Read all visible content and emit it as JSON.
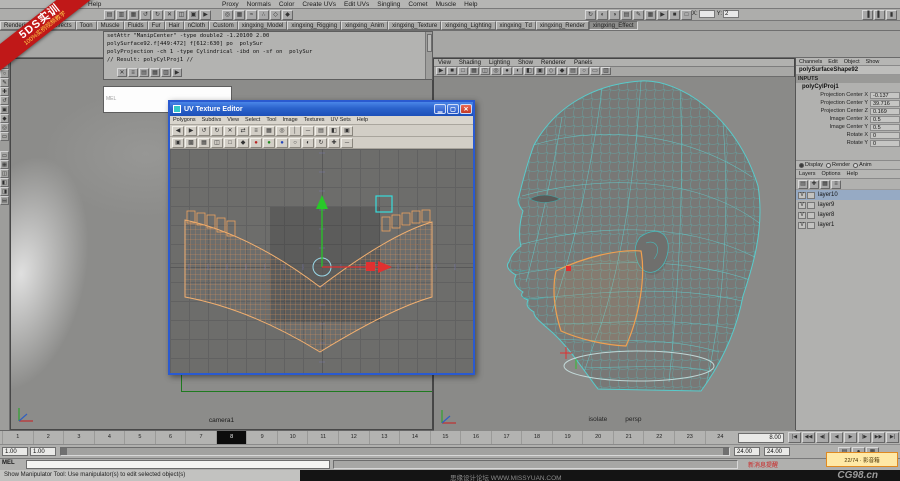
{
  "ribbon": {
    "line1": "5DS实训",
    "line2": "100%实例视频教学"
  },
  "menubar": {
    "script_menu": "Help",
    "items": [
      "Proxy",
      "Normals",
      "Color",
      "Create UVs",
      "Edit UVs",
      "Singling",
      "Comet",
      "Muscle",
      "Help"
    ]
  },
  "statusbar": {
    "left_icons": [
      {
        "n": "new-scene-icon",
        "g": "▤"
      },
      {
        "n": "open-scene-icon",
        "g": "▥"
      },
      {
        "n": "save-scene-icon",
        "g": "▦"
      },
      {
        "n": "undo-icon",
        "g": "↺"
      },
      {
        "n": "redo-icon",
        "g": "↻"
      },
      {
        "n": "cut-icon",
        "g": "✕"
      },
      {
        "n": "copy-icon",
        "g": "◫"
      },
      {
        "n": "paste-icon",
        "g": "▣"
      },
      {
        "n": "select-mode-icon",
        "g": "▶"
      }
    ],
    "mid_icons": [
      {
        "n": "highlight-selection-icon",
        "g": "◎"
      },
      {
        "n": "snap-grid-icon",
        "g": "▦"
      },
      {
        "n": "snap-curve-icon",
        "g": "≈"
      },
      {
        "n": "snap-point-icon",
        "g": "∴"
      },
      {
        "n": "snap-plane-icon",
        "g": "◇"
      },
      {
        "n": "make-live-icon",
        "g": "◆"
      }
    ],
    "right_icons": [
      {
        "n": "construction-history-icon",
        "g": "↻"
      },
      {
        "n": "render-current-frame-icon",
        "g": "◐"
      },
      {
        "n": "ipr-render-icon",
        "g": "◑"
      },
      {
        "n": "render-settings-icon",
        "g": "▤"
      },
      {
        "n": "paint-effects-icon",
        "g": "✎"
      },
      {
        "n": "hypershade-icon",
        "g": "▦"
      },
      {
        "n": "quick-select-icon",
        "g": "▶"
      },
      {
        "n": "object-mode-icon",
        "g": "■"
      },
      {
        "n": "component-mode-icon",
        "g": "□"
      }
    ],
    "coord_fields": [
      {
        "label": "X:",
        "value": ""
      },
      {
        "label": "Y:",
        "value": "2"
      }
    ],
    "panel_toggles": [
      {
        "n": "toggle-attribute-editor-icon",
        "g": "▐"
      },
      {
        "n": "toggle-tool-settings-icon",
        "g": "▌"
      },
      {
        "n": "toggle-channel-box-icon",
        "g": "▮"
      }
    ]
  },
  "shelf": {
    "tabs": [
      "Rendering",
      "PaintEffects",
      "Toon",
      "Muscle",
      "Fluids",
      "Fur",
      "Hair",
      "nCloth",
      "Custom",
      "xingxing_Model",
      "xingxing_Rigging",
      "xingxing_Anim",
      "xingxing_Texture",
      "xingxing_Lighting",
      "xingxing_Td",
      "xingxing_Render",
      "xingxing_Effect"
    ],
    "active": "xingxing_Effect"
  },
  "toolbox": {
    "tools": [
      {
        "n": "select-tool-icon",
        "g": "▶"
      },
      {
        "n": "lasso-tool-icon",
        "g": "○"
      },
      {
        "n": "paint-select-tool-icon",
        "g": "✎"
      },
      {
        "n": "move-tool-icon",
        "g": "✚"
      },
      {
        "n": "rotate-tool-icon",
        "g": "↺"
      },
      {
        "n": "scale-tool-icon",
        "g": "▣"
      },
      {
        "n": "universal-manip-tool-icon",
        "g": "◆"
      },
      {
        "n": "show-manip-tool-icon",
        "g": "◎"
      },
      {
        "n": "last-tool-icon",
        "g": "▭"
      }
    ],
    "layouts": [
      {
        "n": "single-pane-layout-icon",
        "g": "▭"
      },
      {
        "n": "four-pane-layout-icon",
        "g": "▦"
      },
      {
        "n": "two-pane-layout-icon",
        "g": "◫"
      },
      {
        "n": "persp-outliner-layout-icon",
        "g": "◧"
      },
      {
        "n": "persp-graph-layout-icon",
        "g": "◨"
      },
      {
        "n": "uv-persp-layout-icon",
        "g": "▤"
      }
    ]
  },
  "script_panel": {
    "output_lines": [
      "setAttr \"ManipCenter\" -type double2 -1.20100 2.00",
      "polySurface92.f[449:472] f[612:630] po  polySur",
      "polyProjection -ch 1 -type Cylindrical -ibd on -sf on  polySur",
      "// Result: polyCylProj1 //"
    ],
    "icons": [
      {
        "n": "clear-history-icon",
        "g": "✕"
      },
      {
        "n": "echo-commands-icon",
        "g": "≡"
      },
      {
        "n": "line-numbers-icon",
        "g": "▤"
      },
      {
        "n": "save-script-icon",
        "g": "▦"
      },
      {
        "n": "load-script-icon",
        "g": "▥"
      },
      {
        "n": "execute-script-icon",
        "g": "▶"
      }
    ],
    "input_label": "MEL"
  },
  "left_viewport": {
    "camera_label": "camera1",
    "icons": [
      {
        "n": "camera-attributes-icon",
        "g": "▣"
      },
      {
        "n": "bookmark-icon",
        "g": "◆"
      },
      {
        "n": "image-plane-icon",
        "g": "▦"
      },
      {
        "n": "pan-zoom-icon",
        "g": "✚"
      },
      {
        "n": "grease-pencil-icon",
        "g": "✎"
      },
      {
        "n": "film-gate-icon",
        "g": "□"
      }
    ]
  },
  "right_viewport": {
    "menus": [
      "View",
      "Shading",
      "Lighting",
      "Show",
      "Renderer",
      "Panels"
    ],
    "icons": [
      {
        "n": "select-camera-icon",
        "g": "▶"
      },
      {
        "n": "lock-camera-icon",
        "g": "■"
      },
      {
        "n": "camera-attributes-icon",
        "g": "□"
      },
      {
        "n": "grid-toggle-icon",
        "g": "▦"
      },
      {
        "n": "film-gate-icon",
        "g": "◫"
      },
      {
        "n": "resolution-gate-icon",
        "g": "◎"
      },
      {
        "n": "gate-mask-icon",
        "g": "●"
      },
      {
        "n": "field-chart-icon",
        "g": "◐"
      },
      {
        "n": "safe-action-icon",
        "g": "◧"
      },
      {
        "n": "safe-title-icon",
        "g": "▣"
      },
      {
        "n": "wireframe-display-icon",
        "g": "◇"
      },
      {
        "n": "smooth-shade-icon",
        "g": "◆"
      },
      {
        "n": "textured-display-icon",
        "g": "▤"
      },
      {
        "n": "lights-display-icon",
        "g": "○"
      },
      {
        "n": "isolate-select-icon",
        "g": "▭"
      },
      {
        "n": "xray-display-icon",
        "g": "▥"
      }
    ],
    "labels": {
      "left": "isolate",
      "right": "persp"
    }
  },
  "uv_editor": {
    "title": "UV Texture Editor",
    "menus": [
      "Polygons",
      "Subdivs",
      "View",
      "Select",
      "Tool",
      "Image",
      "Textures",
      "UV Sets",
      "Help"
    ],
    "window_buttons": [
      {
        "n": "minimize-button",
        "g": "▁"
      },
      {
        "n": "maximize-button",
        "g": "▢"
      }
    ],
    "close_button": "✕",
    "toolbar1": [
      {
        "n": "flip-u-icon",
        "g": "◀"
      },
      {
        "n": "flip-v-icon",
        "g": "▶"
      },
      {
        "n": "rotate-uv-ccw-icon",
        "g": "↺"
      },
      {
        "n": "rotate-uv-cw-icon",
        "g": "↻"
      },
      {
        "n": "cut-uv-icon",
        "g": "✕"
      },
      {
        "n": "sew-uv-icon",
        "g": "⇄"
      },
      {
        "n": "move-sew-uv-icon",
        "g": "≡"
      },
      {
        "n": "layout-uv-icon",
        "g": "▦"
      },
      {
        "n": "cycle-uv-icon",
        "g": "◎"
      },
      {
        "n": "align-u-icon",
        "g": "│"
      },
      {
        "n": "align-v-icon",
        "g": "─"
      },
      {
        "n": "grid-uv-icon",
        "g": "▤"
      },
      {
        "n": "isolate-uv-icon",
        "g": "◧"
      },
      {
        "n": "uv-options-icon",
        "g": "▣"
      }
    ],
    "toolbar2": [
      {
        "n": "display-image-icon",
        "g": "▣"
      },
      {
        "n": "dim-image-icon",
        "g": "▩"
      },
      {
        "n": "view-grid-icon",
        "g": "▦"
      },
      {
        "n": "pixel-snap-icon",
        "g": "◫"
      },
      {
        "n": "texture-borders-icon",
        "g": "□"
      },
      {
        "n": "shaded-uv-icon",
        "g": "◆"
      },
      {
        "n": "red-channel-icon",
        "g": "●"
      },
      {
        "n": "green-channel-icon",
        "g": "●"
      },
      {
        "n": "blue-channel-icon",
        "g": "●"
      },
      {
        "n": "alpha-channel-icon",
        "g": "○"
      },
      {
        "n": "uv-snapshot-icon",
        "g": "◐"
      },
      {
        "n": "refresh-view-icon",
        "g": "↻"
      },
      {
        "n": "zoom-in-icon",
        "g": "✚"
      },
      {
        "n": "zoom-out-icon",
        "g": "─"
      }
    ]
  },
  "channel_box": {
    "menus": [
      "Channels",
      "Edit",
      "Object",
      "Show"
    ],
    "object_name": "polySurfaceShape92",
    "section": "INPUTS",
    "node_name": "polyCylProj1",
    "attributes": [
      {
        "label": "Projection Center X",
        "value": "-0.137"
      },
      {
        "label": "Projection Center Y",
        "value": "39.716"
      },
      {
        "label": "Projection Center Z",
        "value": "0.169"
      },
      {
        "label": "Image Center X",
        "value": "0.5"
      },
      {
        "label": "Image Center Y",
        "value": "0.5"
      },
      {
        "label": "Rotate X",
        "value": "0"
      },
      {
        "label": "Rotate Y",
        "value": "0"
      }
    ],
    "display_modes": [
      "Display",
      "Render",
      "Anim"
    ],
    "display_selected": "Display",
    "layers_menus": [
      "Layers",
      "Options",
      "Help"
    ],
    "layers_toolbar": [
      {
        "n": "new-empty-layer-icon",
        "g": "▤"
      },
      {
        "n": "new-layer-icon",
        "g": "✚"
      },
      {
        "n": "new-layer-from-selected-icon",
        "g": "▦"
      },
      {
        "n": "layer-options-icon",
        "g": "≡"
      }
    ],
    "layers": [
      {
        "name": "layer10",
        "visible": "V"
      },
      {
        "name": "layer9",
        "visible": "V"
      },
      {
        "name": "layer8",
        "visible": "V"
      },
      {
        "name": "layer1",
        "visible": "V"
      }
    ],
    "selected_layer": "layer10"
  },
  "timeline": {
    "frames": [
      "1",
      "2",
      "3",
      "4",
      "5",
      "6",
      "7",
      "8",
      "9",
      "10",
      "11",
      "12",
      "13",
      "14",
      "15",
      "16",
      "17",
      "18",
      "19",
      "20",
      "21",
      "22",
      "23",
      "24"
    ],
    "current_frame": "8",
    "current_time": "8.00",
    "playback": [
      {
        "n": "go-to-start-icon",
        "g": "|◀"
      },
      {
        "n": "step-back-key-icon",
        "g": "◀◀"
      },
      {
        "n": "step-back-frame-icon",
        "g": "◀|"
      },
      {
        "n": "play-backward-icon",
        "g": "◀"
      },
      {
        "n": "play-forward-icon",
        "g": "▶"
      },
      {
        "n": "step-fwd-frame-icon",
        "g": "|▶"
      },
      {
        "n": "step-fwd-key-icon",
        "g": "▶▶"
      },
      {
        "n": "go-to-end-icon",
        "g": "▶|"
      }
    ]
  },
  "range_slider": {
    "anim_start": "1.00",
    "play_start": "1.00",
    "play_end": "24.00",
    "anim_end": "24.00",
    "buttons": [
      {
        "n": "character-set-icon",
        "g": "▤"
      },
      {
        "n": "auto-key-icon",
        "g": "●"
      },
      {
        "n": "anim-preferences-icon",
        "g": "▦"
      }
    ]
  },
  "command_line": {
    "label": "MEL",
    "value": ""
  },
  "help_line": {
    "text": "Show Manipulator Tool: Use manipulator(s) to edit selected object(s)"
  },
  "watermarks": {
    "center": "思缘设计论坛 WWW.MISSYUAN.COM",
    "right": "CG98.cn"
  },
  "tray": {
    "badge": "22/74 · 影音箱",
    "alert": "新消息提醒"
  },
  "colors": {
    "wireframe": "#58cccc",
    "uv_shell": "#f0a060",
    "manip_green": "#28c828",
    "manip_red": "#e03030",
    "selection_box": "#38dcdc",
    "titlebar_blue": "#2b63cc",
    "projection_green": "#1f7a1f"
  }
}
